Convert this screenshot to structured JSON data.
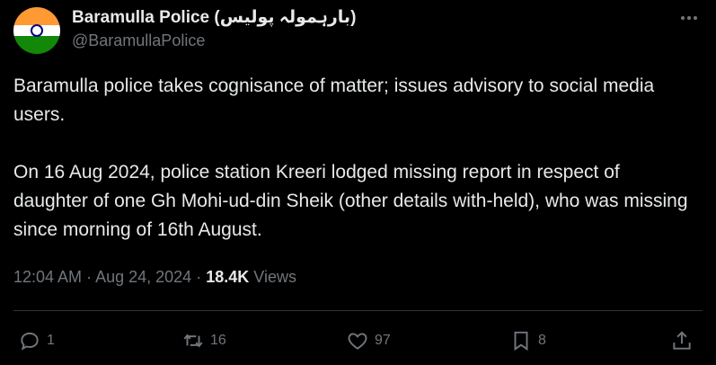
{
  "author": {
    "display_name": "Baramulla Police (بارہمولہ پولیس)",
    "handle": "@BaramullaPolice"
  },
  "tweet": {
    "paragraphs": [
      "Baramulla police takes cognisance of matter; issues advisory to social media users.",
      "On 16 Aug 2024, police station Kreeri lodged missing report in respect of daughter of one Gh Mohi-ud-din Sheik (other details with-held), who was missing since morning of 16th August."
    ]
  },
  "meta": {
    "time": "12:04 AM",
    "separator": "·",
    "date": "Aug 24, 2024",
    "views_count": "18.4K",
    "views_label": "Views"
  },
  "actions": {
    "replies": "1",
    "reposts": "16",
    "likes": "97",
    "bookmarks": "8"
  },
  "icons": {
    "more": "more-horizontal-icon",
    "reply": "reply-icon",
    "repost": "repost-icon",
    "like": "heart-icon",
    "bookmark": "bookmark-icon",
    "share": "share-icon"
  },
  "colors": {
    "background": "#000000",
    "text": "#e7e9ea",
    "secondary": "#71767b",
    "divider": "#2f3336"
  }
}
